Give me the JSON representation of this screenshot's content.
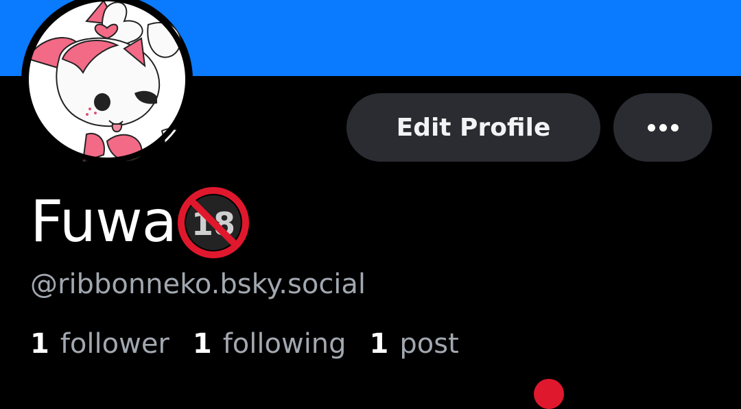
{
  "profile": {
    "display_name": "Fuwa",
    "badge_label": "18",
    "handle": "@ribbonneko.bsky.social"
  },
  "actions": {
    "edit_label": "Edit Profile",
    "more_icon": "ellipsis-icon"
  },
  "stats": [
    {
      "count": "1",
      "label": "follower"
    },
    {
      "count": "1",
      "label": "following"
    },
    {
      "count": "1",
      "label": "post"
    }
  ],
  "colors": {
    "banner": "#0a7aff",
    "background": "#000000",
    "button": "#2a2c31",
    "secondary_text": "#a2a8b0",
    "prohibited_red": "#e0182d"
  }
}
